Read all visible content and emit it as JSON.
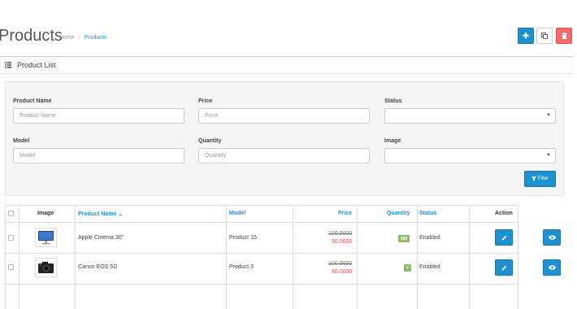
{
  "header": {
    "title": "Products",
    "breadcrumb": [
      {
        "label": "Home"
      },
      {
        "label": "Products"
      }
    ]
  },
  "panel": {
    "title": "Product List"
  },
  "filter": {
    "product_name": {
      "label": "Product Name",
      "placeholder": "Product Name"
    },
    "price": {
      "label": "Price",
      "placeholder": "Price"
    },
    "status": {
      "label": "Status",
      "value": ""
    },
    "model": {
      "label": "Model",
      "placeholder": "Model"
    },
    "quantity": {
      "label": "Quantity",
      "placeholder": "Quantity"
    },
    "image": {
      "label": "Image",
      "value": ""
    },
    "button_label": "Filter"
  },
  "table": {
    "columns": {
      "image": "Image",
      "product_name": "Product Name",
      "model": "Model",
      "price": "Price",
      "quantity": "Quantity",
      "status": "Status",
      "action": "Action"
    },
    "sorted_column": "product_name",
    "sort_direction": "desc",
    "rows": [
      {
        "image": "monitor-icon",
        "name": "Apple Cinema 30\"",
        "model": "Product 15",
        "price_old": "100.0000",
        "price_new": "90.0000",
        "quantity": "990",
        "status": "Enabled"
      },
      {
        "image": "camera-icon",
        "name": "Canon EOS 5D",
        "model": "Product 3",
        "price_old": "100.0000",
        "price_new": "80.0000",
        "quantity": "7",
        "status": "Enabled"
      }
    ]
  },
  "colors": {
    "primary": "#1e91cf",
    "danger": "#f56b6b",
    "success_badge": "#8fbb6c",
    "special_price": "#e05050"
  }
}
